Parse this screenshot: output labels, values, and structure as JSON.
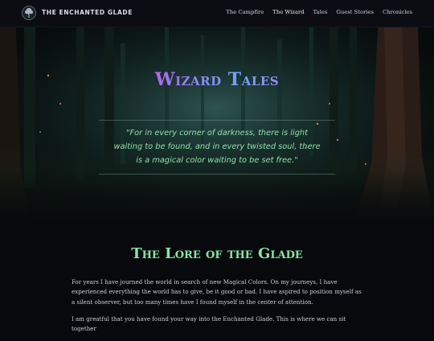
{
  "nav": {
    "brand": "THE ENCHANTED GLADE",
    "logo_icon": "tree-icon",
    "links": [
      "The Campfire",
      "The Wizard",
      "Tales",
      "Guest Stories",
      "Chronicles"
    ]
  },
  "hero": {
    "title": "Wizard Tales",
    "quote": "\"For in every corner of darkness, there is light waiting to be found, and in every twisted soul, there is a magical color waiting to be set free.\""
  },
  "lore": {
    "title": "The Lore of the Glade",
    "paragraphs": [
      "For years I have journed the world in search of new Magical Colors. On my journeys, I have experienced everything the world has to give, be it good or bad. I have aspired to position myself as a silent observer, but too many times have I found myself in the center of attention.",
      "I am greatful that you have found your way into the Enchanted Glade. This is where we can sit together"
    ]
  },
  "colors": {
    "background": "#07090c",
    "accent_green": "#86e6a6",
    "quote_green": "#8ee0a4"
  }
}
